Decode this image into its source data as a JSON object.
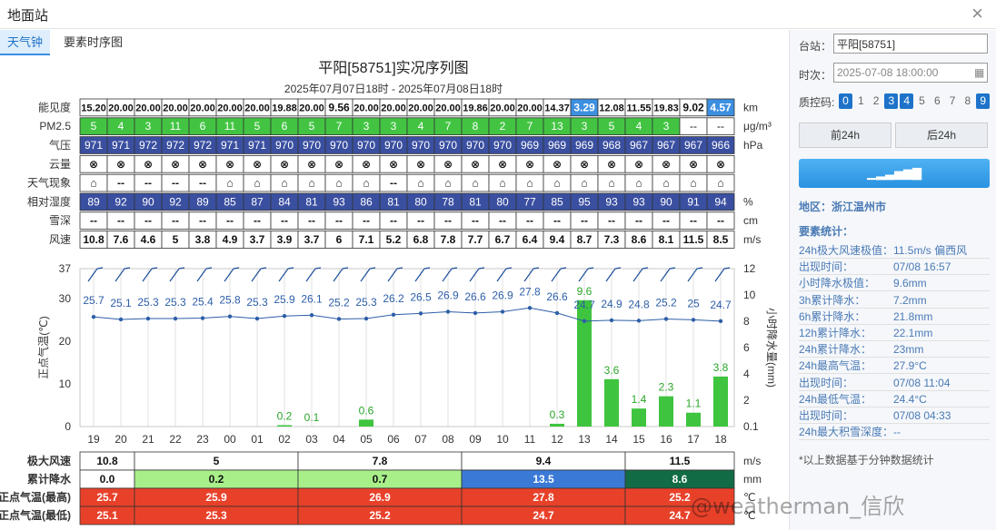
{
  "window": {
    "title": "地面站"
  },
  "tabs": [
    {
      "label": "天气钟"
    },
    {
      "label": "要素时序图"
    }
  ],
  "chart": {
    "title": "平阳[58751]实况序列图",
    "subtitle": "2025年07月07日18时 - 2025年07月08日18时",
    "hours": [
      "19",
      "20",
      "21",
      "22",
      "23",
      "00",
      "01",
      "02",
      "03",
      "04",
      "05",
      "06",
      "07",
      "08",
      "09",
      "10",
      "11",
      "12",
      "13",
      "14",
      "15",
      "16",
      "17",
      "18"
    ],
    "rows": [
      {
        "label": "能见度",
        "unit": "km",
        "style": "vis",
        "values": [
          "15.20",
          "20.00",
          "20.00",
          "20.00",
          "20.00",
          "20.00",
          "20.00",
          "19.88",
          "20.00",
          "9.56",
          "20.00",
          "20.00",
          "20.00",
          "20.00",
          "19.86",
          "20.00",
          "20.00",
          "14.37",
          "3.29",
          "12.08",
          "11.55",
          "19.83",
          "9.02",
          "4.57"
        ]
      },
      {
        "label": "PM2.5",
        "unit": "μg/m³",
        "style": "pm",
        "values": [
          "5",
          "4",
          "3",
          "11",
          "6",
          "11",
          "5",
          "6",
          "5",
          "7",
          "3",
          "3",
          "4",
          "7",
          "8",
          "2",
          "7",
          "13",
          "3",
          "5",
          "4",
          "3",
          "--",
          "--"
        ]
      },
      {
        "label": "气压",
        "unit": "hPa",
        "style": "dark",
        "values": [
          "971",
          "971",
          "972",
          "972",
          "972",
          "971",
          "971",
          "970",
          "970",
          "970",
          "970",
          "970",
          "970",
          "970",
          "970",
          "970",
          "969",
          "969",
          "969",
          "968",
          "967",
          "967",
          "967",
          "966"
        ]
      },
      {
        "label": "云量",
        "unit": "",
        "style": "plain",
        "values": [
          "⊗",
          "⊗",
          "⊗",
          "⊗",
          "⊗",
          "⊗",
          "⊗",
          "⊗",
          "⊗",
          "⊗",
          "⊗",
          "⊗",
          "⊗",
          "⊗",
          "⊗",
          "⊗",
          "⊗",
          "⊗",
          "⊗",
          "⊗",
          "⊗",
          "⊗",
          "⊗",
          "⊗"
        ]
      },
      {
        "label": "天气现象",
        "unit": "",
        "style": "plain",
        "values": [
          "⌂",
          "--",
          "--",
          "--",
          "--",
          "⌂",
          "⌂",
          "⌂",
          "⌂",
          "⌂",
          "⌂",
          "--",
          "⌂",
          "⌂",
          "⌂",
          "⌂",
          "⌂",
          "⌂",
          "⌂",
          "⌂",
          "⌂",
          "⌂",
          "⌂",
          "⌂"
        ]
      },
      {
        "label": "相对湿度",
        "unit": "%",
        "style": "dark",
        "values": [
          "89",
          "92",
          "90",
          "92",
          "89",
          "85",
          "87",
          "84",
          "81",
          "93",
          "86",
          "81",
          "80",
          "78",
          "81",
          "80",
          "77",
          "85",
          "95",
          "93",
          "93",
          "90",
          "91",
          "94"
        ]
      },
      {
        "label": "雪深",
        "unit": "cm",
        "style": "plain",
        "values": [
          "--",
          "--",
          "--",
          "--",
          "--",
          "--",
          "--",
          "--",
          "--",
          "--",
          "--",
          "--",
          "--",
          "--",
          "--",
          "--",
          "--",
          "--",
          "--",
          "--",
          "--",
          "--",
          "--",
          "--"
        ]
      },
      {
        "label": "风速",
        "unit": "m/s",
        "style": "plain",
        "values": [
          "10.8",
          "7.6",
          "4.6",
          "5",
          "3.8",
          "4.9",
          "3.7",
          "3.9",
          "3.7",
          "6",
          "7.1",
          "5.2",
          "6.8",
          "7.8",
          "7.7",
          "6.7",
          "6.4",
          "9.4",
          "8.7",
          "7.3",
          "8.6",
          "8.1",
          "11.5",
          "8.5"
        ]
      }
    ],
    "colors": {
      "vis_normal": "#ffffff",
      "vis_low": "#3d8fe0",
      "pm": "#42c442",
      "dark": "#3a4fa0",
      "temp_line": "#2d5ea8",
      "rain_bar": "#3ec43e",
      "summary_red": "#e8412a"
    },
    "summary": {
      "unit_wind": "m/s",
      "unit_rain": "mm",
      "unit_temp": "℃",
      "wind_label": "极大风速",
      "rain_label": "累计降水",
      "tmax_label": "正点气温(最高)",
      "tmin_label": "正点气温(最低)",
      "wind": [
        "10.8",
        "5",
        "7.8",
        "9.4",
        "11.5"
      ],
      "rain": [
        "0.0",
        "0.2",
        "0.7",
        "13.5",
        "8.6"
      ],
      "tmax": [
        "25.7",
        "25.9",
        "26.9",
        "27.8",
        "25.2"
      ],
      "tmin": [
        "25.1",
        "25.3",
        "25.2",
        "24.7",
        "24.7"
      ]
    }
  },
  "chart_data": {
    "type": "line",
    "x": [
      "19",
      "20",
      "21",
      "22",
      "23",
      "00",
      "01",
      "02",
      "03",
      "04",
      "05",
      "06",
      "07",
      "08",
      "09",
      "10",
      "11",
      "12",
      "13",
      "14",
      "15",
      "16",
      "17",
      "18"
    ],
    "ylabel": "正点气温(℃)",
    "y2label": "小时降水量(mm)",
    "ylim": [
      0,
      37
    ],
    "y2ticks": [
      0.1,
      2,
      4,
      6,
      8,
      10,
      12
    ],
    "yticks": [
      0,
      10,
      20,
      30,
      37
    ],
    "series": [
      {
        "name": "正点气温(℃)",
        "type": "line",
        "values": [
          25.7,
          25.1,
          25.3,
          25.3,
          25.4,
          25.8,
          25.3,
          25.9,
          26.1,
          25.2,
          25.3,
          26.2,
          26.5,
          26.9,
          26.6,
          26.9,
          27.8,
          26.6,
          24.7,
          24.9,
          24.8,
          25.2,
          25,
          24.7
        ]
      },
      {
        "name": "小时降水量(mm)",
        "type": "bar",
        "values": [
          0,
          0,
          0,
          0,
          0,
          0,
          0,
          0.2,
          0.1,
          0,
          0.6,
          0,
          0,
          0,
          0,
          0,
          0,
          0.3,
          9.6,
          3.6,
          1.4,
          2.3,
          1.1,
          3.8
        ]
      }
    ]
  },
  "side": {
    "station_label": "台站：",
    "station_value": "平阳[58751]",
    "time_label": "时次：",
    "time_value": "2025-07-08 18:00:00",
    "qc_label": "质控码:",
    "qc_codes": [
      {
        "v": "0",
        "on": true
      },
      {
        "v": "1",
        "on": false
      },
      {
        "v": "2",
        "on": false
      },
      {
        "v": "3",
        "on": true
      },
      {
        "v": "4",
        "on": true
      },
      {
        "v": "5",
        "on": false
      },
      {
        "v": "6",
        "on": false
      },
      {
        "v": "7",
        "on": false
      },
      {
        "v": "8",
        "on": false
      },
      {
        "v": "9",
        "on": true
      }
    ],
    "prev_label": "前24h",
    "next_label": "后24h",
    "region": "地区：浙江温州市",
    "stats_title": "要素统计：",
    "stats": [
      {
        "k": "24h极大风速极值：",
        "v": "11.5m/s 偏西风"
      },
      {
        "k": "出现时间：",
        "v": "07/08 16:57"
      },
      {
        "k": "小时降水极值：",
        "v": "9.6mm"
      },
      {
        "k": "3h累计降水：",
        "v": "7.2mm"
      },
      {
        "k": "6h累计降水：",
        "v": "21.8mm"
      },
      {
        "k": "12h累计降水：",
        "v": "22.1mm"
      },
      {
        "k": "24h累计降水：",
        "v": "23mm"
      },
      {
        "k": "24h最高气温：",
        "v": "27.9°C"
      },
      {
        "k": "出现时间：",
        "v": "07/08 11:04"
      },
      {
        "k": "24h最低气温：",
        "v": "24.4°C"
      },
      {
        "k": "出现时间：",
        "v": "07/08 04:33"
      },
      {
        "k": "24h最大积雪深度：--",
        "v": ""
      }
    ],
    "note": "*以上数据基于分钟数据统计"
  },
  "watermark": "@weatherman_信欣"
}
